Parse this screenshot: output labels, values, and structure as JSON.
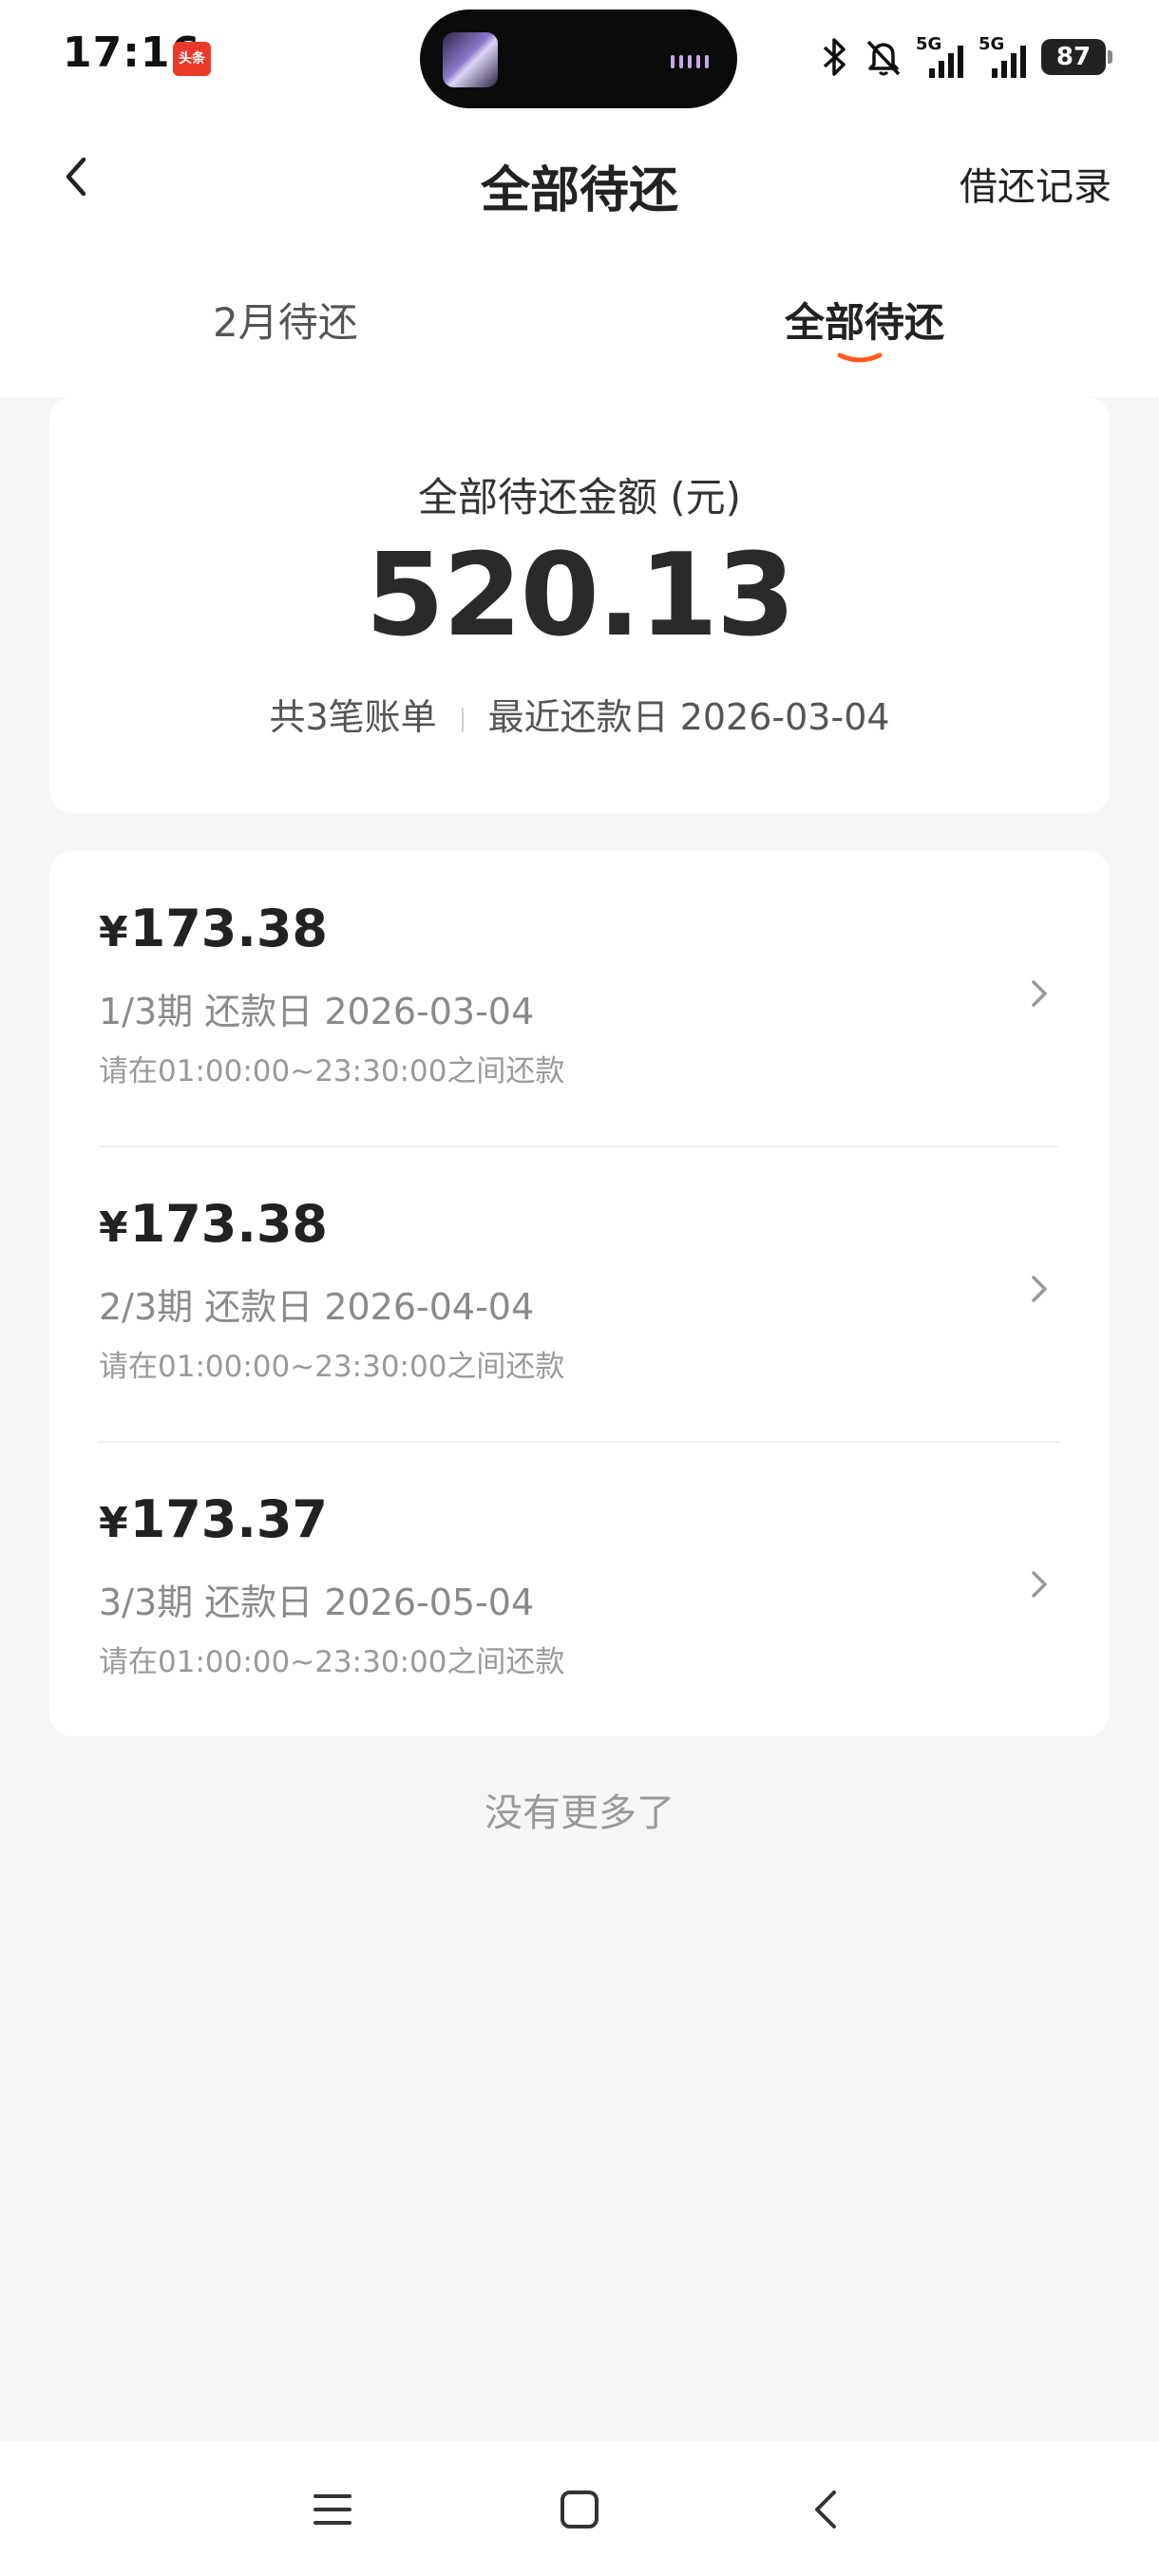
{
  "status_bar": {
    "time": "17:16",
    "app_badge": "头条",
    "signal_1": "5G",
    "signal_2": "5G",
    "battery": "87"
  },
  "header": {
    "title": "全部待还",
    "right_action": "借还记录"
  },
  "tabs": [
    {
      "label": "2月待还",
      "active": false
    },
    {
      "label": "全部待还",
      "active": true
    }
  ],
  "summary": {
    "label": "全部待还金额 (元)",
    "amount": "520.13",
    "count_text": "共3笔账单",
    "next_due_text": "最近还款日 2026-03-04"
  },
  "bills": [
    {
      "currency": "¥",
      "amount": "173.38",
      "due": "1/3期 还款日 2026-03-04",
      "hint": "请在01:00:00~23:30:00之间还款"
    },
    {
      "currency": "¥",
      "amount": "173.38",
      "due": "2/3期 还款日 2026-04-04",
      "hint": "请在01:00:00~23:30:00之间还款"
    },
    {
      "currency": "¥",
      "amount": "173.37",
      "due": "3/3期 还款日 2026-05-04",
      "hint": "请在01:00:00~23:30:00之间还款"
    }
  ],
  "footer_text": "没有更多了",
  "colors": {
    "accent": "#ff5a1f",
    "background": "#f6f6f6",
    "card": "#ffffff"
  }
}
